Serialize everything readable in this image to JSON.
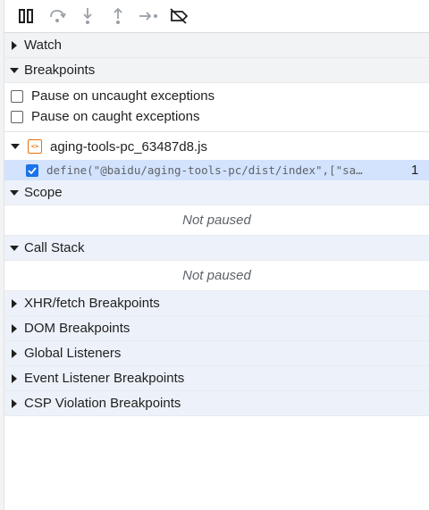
{
  "toolbar": {
    "buttons": [
      {
        "name": "pause-resume-icon"
      },
      {
        "name": "step-over-icon"
      },
      {
        "name": "step-into-icon"
      },
      {
        "name": "step-out-icon"
      },
      {
        "name": "step-icon"
      },
      {
        "name": "deactivate-breakpoints-icon"
      }
    ]
  },
  "sections": {
    "watch": "Watch",
    "breakpoints": "Breakpoints",
    "scope": "Scope",
    "call_stack": "Call Stack",
    "xhr": "XHR/fetch Breakpoints",
    "dom": "DOM Breakpoints",
    "global": "Global Listeners",
    "event": "Event Listener Breakpoints",
    "csp": "CSP Violation Breakpoints"
  },
  "breakpoints": {
    "pause_uncaught": "Pause on uncaught exceptions",
    "pause_caught": "Pause on caught exceptions",
    "file_name": "aging-tools-pc_63487d8.js",
    "line_code": "define(\"@baidu/aging-tools-pc/dist/index\",[\"sa…",
    "line_number": "1"
  },
  "scope": {
    "status": "Not paused"
  },
  "call_stack": {
    "status": "Not paused"
  },
  "colors": {
    "accent": "#1a73e8",
    "header_bg": "#edf2fa",
    "selected_bg": "#d3e3fd",
    "file_icon": "#e8710a"
  }
}
